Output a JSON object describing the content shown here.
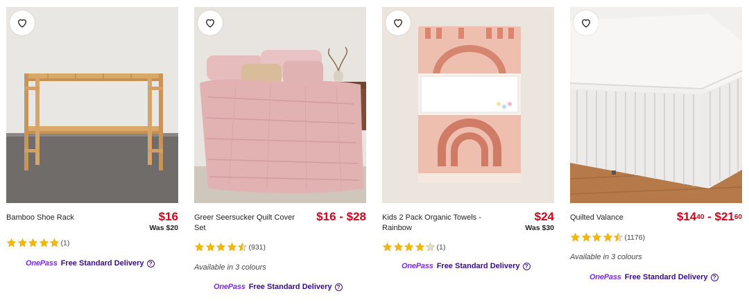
{
  "colors": {
    "price": "#d0021b",
    "star": "#f5b800",
    "onepass": "#7b2ae0",
    "delivery": "#3a0a8a"
  },
  "products": [
    {
      "name": "Bamboo Shoe Rack",
      "price": "$16",
      "was": "Was $20",
      "rating": 5,
      "review_count": "(1)",
      "colours": "",
      "delivery_brand": "OnePass",
      "delivery_text": "Free Standard Delivery",
      "help_icon": "?"
    },
    {
      "name": "Greer Seersucker Quilt Cover Set",
      "price": "$16 - $28",
      "was": "",
      "rating": 4.5,
      "review_count": "(931)",
      "colours": "Available in 3 colours",
      "delivery_brand": "OnePass",
      "delivery_text": "Free Standard Delivery",
      "help_icon": "?"
    },
    {
      "name": "Kids 2 Pack Organic Towels - Rainbow",
      "price": "$24",
      "was": "Was $30",
      "rating": 4,
      "review_count": "(1)",
      "colours": "",
      "delivery_brand": "OnePass",
      "delivery_text": "Free Standard Delivery",
      "help_icon": "?"
    },
    {
      "name": "Quilted Valance",
      "price_low_dollars": "$14",
      "price_low_cents": "40",
      "price_sep": " - ",
      "price_high_dollars": "$21",
      "price_high_cents": "60",
      "was": "",
      "rating": 4.5,
      "review_count": "(1176)",
      "colours": "Available in 3 colours",
      "delivery_brand": "OnePass",
      "delivery_text": "Free Standard Delivery",
      "help_icon": "?"
    }
  ],
  "icons": {
    "wishlist": "heart-outline-icon",
    "rating": "star-icon",
    "help": "question-circle-icon"
  }
}
